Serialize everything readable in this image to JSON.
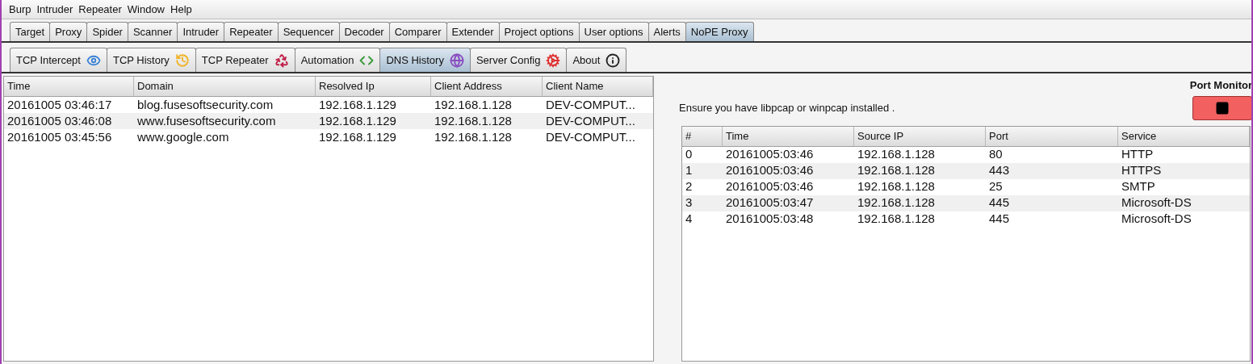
{
  "menu": [
    "Burp",
    "Intruder",
    "Repeater",
    "Window",
    "Help"
  ],
  "tabs": [
    {
      "label": "Target",
      "selected": false
    },
    {
      "label": "Proxy",
      "selected": false
    },
    {
      "label": "Spider",
      "selected": false
    },
    {
      "label": "Scanner",
      "selected": false
    },
    {
      "label": "Intruder",
      "selected": false
    },
    {
      "label": "Repeater",
      "selected": false
    },
    {
      "label": "Sequencer",
      "selected": false
    },
    {
      "label": "Decoder",
      "selected": false
    },
    {
      "label": "Comparer",
      "selected": false
    },
    {
      "label": "Extender",
      "selected": false
    },
    {
      "label": "Project options",
      "selected": false
    },
    {
      "label": "User options",
      "selected": false
    },
    {
      "label": "Alerts",
      "selected": false
    },
    {
      "label": "NoPE Proxy",
      "selected": true
    }
  ],
  "subtabs": [
    {
      "label": "TCP Intercept",
      "selected": false
    },
    {
      "label": "TCP History",
      "selected": false
    },
    {
      "label": "TCP Repeater",
      "selected": false
    },
    {
      "label": "Automation",
      "selected": false
    },
    {
      "label": "DNS History",
      "selected": true
    },
    {
      "label": "Server Config",
      "selected": false
    },
    {
      "label": "About",
      "selected": false
    }
  ],
  "dns_table": {
    "columns": [
      "Time",
      "Domain",
      "Resolved Ip",
      "Client Address",
      "Client Name"
    ],
    "rows": [
      [
        "20161005 03:46:17",
        "blog.fusesoftsecurity.com",
        "192.168.1.129",
        "192.168.1.128",
        "DEV-COMPUT..."
      ],
      [
        "20161005 03:46:08",
        "www.fusesoftsecurity.com",
        "192.168.1.129",
        "192.168.1.128",
        "DEV-COMPUT..."
      ],
      [
        "20161005 03:45:56",
        "www.google.com",
        "192.168.1.129",
        "192.168.1.128",
        "DEV-COMPUT..."
      ]
    ]
  },
  "port_monitor": {
    "title": "Port Monitor",
    "notice": "Ensure you have libpcap or winpcap installed .",
    "table": {
      "columns": [
        "#",
        "Time",
        "Source IP",
        "Port",
        "Service"
      ],
      "rows": [
        [
          "0",
          "20161005:03:46",
          "192.168.1.128",
          "80",
          "HTTP"
        ],
        [
          "1",
          "20161005:03:46",
          "192.168.1.128",
          "443",
          "HTTPS"
        ],
        [
          "2",
          "20161005:03:46",
          "192.168.1.128",
          "25",
          "SMTP"
        ],
        [
          "3",
          "20161005:03:47",
          "192.168.1.128",
          "445",
          "Microsoft-DS"
        ],
        [
          "4",
          "20161005:03:48",
          "192.168.1.128",
          "445",
          "Microsoft-DS"
        ]
      ]
    }
  }
}
